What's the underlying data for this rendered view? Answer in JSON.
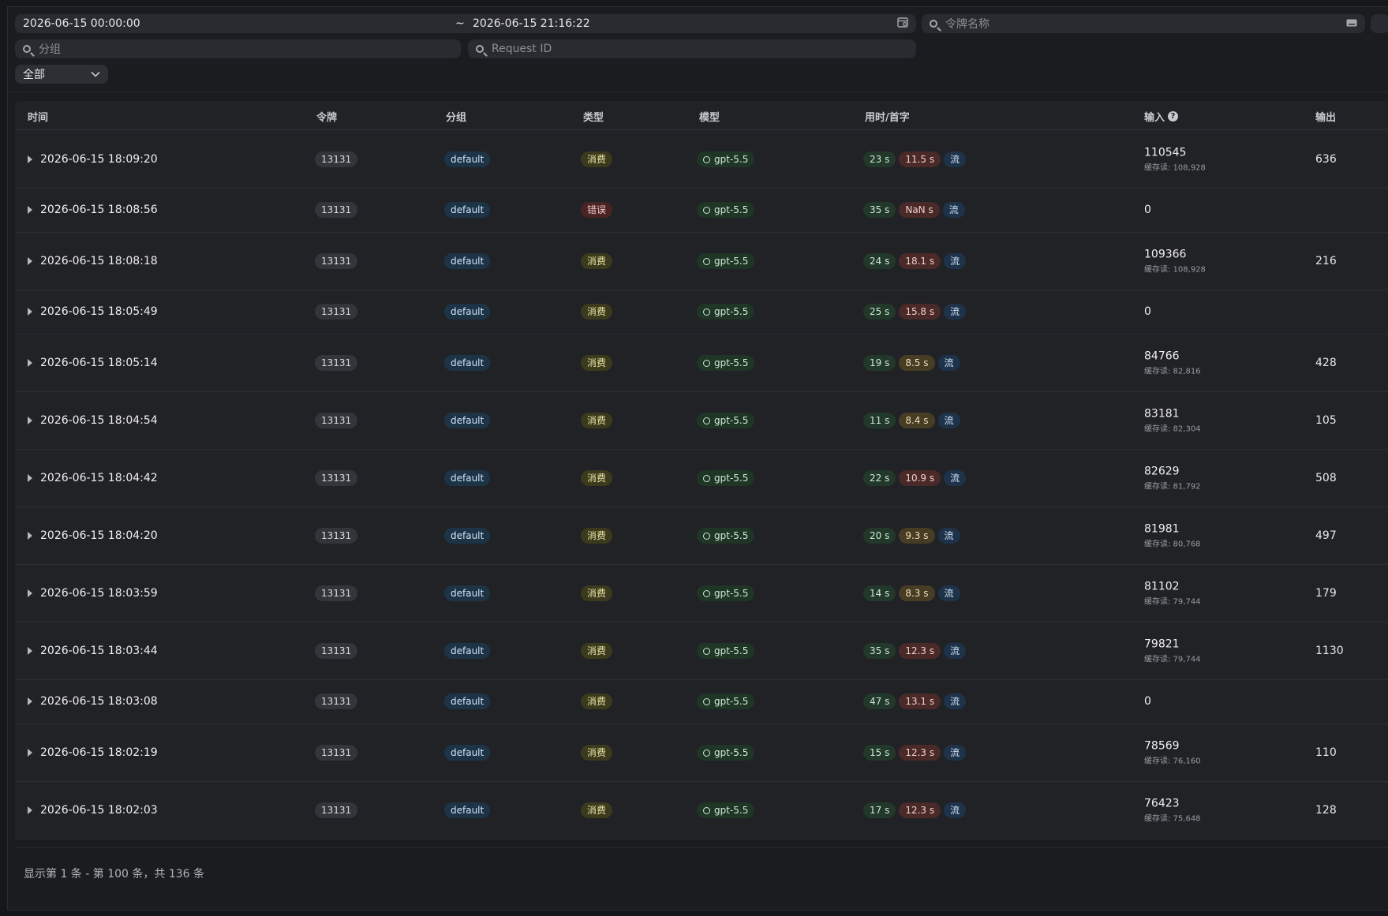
{
  "filters": {
    "date_start": "2026-06-15 00:00:00",
    "date_sep": "~",
    "date_end": "2026-06-15 21:16:22",
    "token_placeholder": "令牌名称",
    "group_placeholder": "分组",
    "request_id_placeholder": "Request ID",
    "type_select": "全部"
  },
  "table": {
    "headers": {
      "time": "时间",
      "token": "令牌",
      "group": "分组",
      "type": "类型",
      "model": "模型",
      "duration": "用时/首字",
      "input": "输入",
      "output": "输出"
    },
    "rows": [
      {
        "time": "2026-06-15 18:09:20",
        "token": "13131",
        "group": "default",
        "type": "消费",
        "type_kind": "consume",
        "model": "gpt-5.5",
        "duration": "23 s",
        "first": "11.5 s",
        "first_kind": "red",
        "stream": "流",
        "input": "110545",
        "cache": "缓存读: 108,928",
        "output": "636"
      },
      {
        "time": "2026-06-15 18:08:56",
        "token": "13131",
        "group": "default",
        "type": "错误",
        "type_kind": "error",
        "model": "gpt-5.5",
        "duration": "35 s",
        "first": "NaN s",
        "first_kind": "red",
        "stream": "流",
        "input": "0",
        "cache": "",
        "output": ""
      },
      {
        "time": "2026-06-15 18:08:18",
        "token": "13131",
        "group": "default",
        "type": "消费",
        "type_kind": "consume",
        "model": "gpt-5.5",
        "duration": "24 s",
        "first": "18.1 s",
        "first_kind": "red",
        "stream": "流",
        "input": "109366",
        "cache": "缓存读: 108,928",
        "output": "216"
      },
      {
        "time": "2026-06-15 18:05:49",
        "token": "13131",
        "group": "default",
        "type": "消费",
        "type_kind": "consume",
        "model": "gpt-5.5",
        "duration": "25 s",
        "first": "15.8 s",
        "first_kind": "red",
        "stream": "流",
        "input": "0",
        "cache": "",
        "output": ""
      },
      {
        "time": "2026-06-15 18:05:14",
        "token": "13131",
        "group": "default",
        "type": "消费",
        "type_kind": "consume",
        "model": "gpt-5.5",
        "duration": "19 s",
        "first": "8.5 s",
        "first_kind": "amber",
        "stream": "流",
        "input": "84766",
        "cache": "缓存读: 82,816",
        "output": "428"
      },
      {
        "time": "2026-06-15 18:04:54",
        "token": "13131",
        "group": "default",
        "type": "消费",
        "type_kind": "consume",
        "model": "gpt-5.5",
        "duration": "11 s",
        "first": "8.4 s",
        "first_kind": "amber",
        "stream": "流",
        "input": "83181",
        "cache": "缓存读: 82,304",
        "output": "105"
      },
      {
        "time": "2026-06-15 18:04:42",
        "token": "13131",
        "group": "default",
        "type": "消费",
        "type_kind": "consume",
        "model": "gpt-5.5",
        "duration": "22 s",
        "first": "10.9 s",
        "first_kind": "red",
        "stream": "流",
        "input": "82629",
        "cache": "缓存读: 81,792",
        "output": "508"
      },
      {
        "time": "2026-06-15 18:04:20",
        "token": "13131",
        "group": "default",
        "type": "消费",
        "type_kind": "consume",
        "model": "gpt-5.5",
        "duration": "20 s",
        "first": "9.3 s",
        "first_kind": "amber",
        "stream": "流",
        "input": "81981",
        "cache": "缓存读: 80,768",
        "output": "497"
      },
      {
        "time": "2026-06-15 18:03:59",
        "token": "13131",
        "group": "default",
        "type": "消费",
        "type_kind": "consume",
        "model": "gpt-5.5",
        "duration": "14 s",
        "first": "8.3 s",
        "first_kind": "amber",
        "stream": "流",
        "input": "81102",
        "cache": "缓存读: 79,744",
        "output": "179"
      },
      {
        "time": "2026-06-15 18:03:44",
        "token": "13131",
        "group": "default",
        "type": "消费",
        "type_kind": "consume",
        "model": "gpt-5.5",
        "duration": "35 s",
        "first": "12.3 s",
        "first_kind": "red",
        "stream": "流",
        "input": "79821",
        "cache": "缓存读: 79,744",
        "output": "1130"
      },
      {
        "time": "2026-06-15 18:03:08",
        "token": "13131",
        "group": "default",
        "type": "消费",
        "type_kind": "consume",
        "model": "gpt-5.5",
        "duration": "47 s",
        "first": "13.1 s",
        "first_kind": "red",
        "stream": "流",
        "input": "0",
        "cache": "",
        "output": ""
      },
      {
        "time": "2026-06-15 18:02:19",
        "token": "13131",
        "group": "default",
        "type": "消费",
        "type_kind": "consume",
        "model": "gpt-5.5",
        "duration": "15 s",
        "first": "12.3 s",
        "first_kind": "red",
        "stream": "流",
        "input": "78569",
        "cache": "缓存读: 76,160",
        "output": "110"
      },
      {
        "time": "2026-06-15 18:02:03",
        "token": "13131",
        "group": "default",
        "type": "消费",
        "type_kind": "consume",
        "model": "gpt-5.5",
        "duration": "17 s",
        "first": "12.3 s",
        "first_kind": "red",
        "stream": "流",
        "input": "76423",
        "cache": "缓存读: 75,648",
        "output": "128"
      }
    ]
  },
  "footer": {
    "summary": "显示第 1 条 - 第 100 条，共 136 条"
  }
}
